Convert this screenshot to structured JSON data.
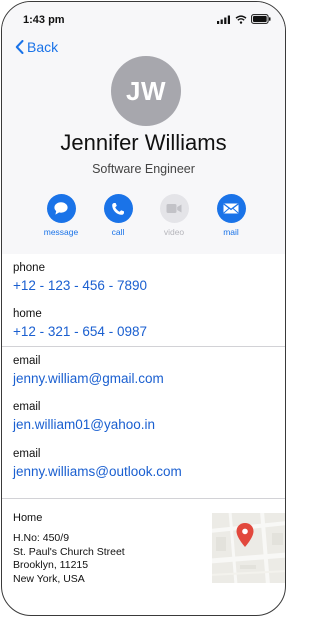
{
  "status_bar": {
    "time": "1:43 pm"
  },
  "nav": {
    "back_label": "Back"
  },
  "contact": {
    "initials": "JW",
    "name": "Jennifer Williams",
    "title": "Software Engineer"
  },
  "actions": [
    {
      "label": "message",
      "icon": "message-icon",
      "enabled": true
    },
    {
      "label": "call",
      "icon": "phone-icon",
      "enabled": true
    },
    {
      "label": "video",
      "icon": "video-icon",
      "enabled": false
    },
    {
      "label": "mail",
      "icon": "mail-icon",
      "enabled": true
    }
  ],
  "phones": [
    {
      "label": "phone",
      "value": "+12 - 123 - 456 - 7890"
    },
    {
      "label": "home",
      "value": "+12 - 321 - 654 - 0987"
    }
  ],
  "emails": [
    {
      "label": "email",
      "value": "jenny.william@gmail.com"
    },
    {
      "label": "email",
      "value": "jen.william01@yahoo.in"
    },
    {
      "label": "email",
      "value": "jenny.williams@outlook.com"
    }
  ],
  "address": {
    "label": "Home",
    "lines": [
      "H.No: 450/9",
      "St. Paul's Church Street",
      "Brooklyn, 11215",
      "New York, USA"
    ]
  },
  "colors": {
    "accent": "#1a73e8",
    "link": "#1a5fd0",
    "avatar_bg": "#a7a7ad",
    "header_bg": "#f7f7f9",
    "disabled": "#e4e4e8",
    "map_pin": "#e2483d"
  }
}
